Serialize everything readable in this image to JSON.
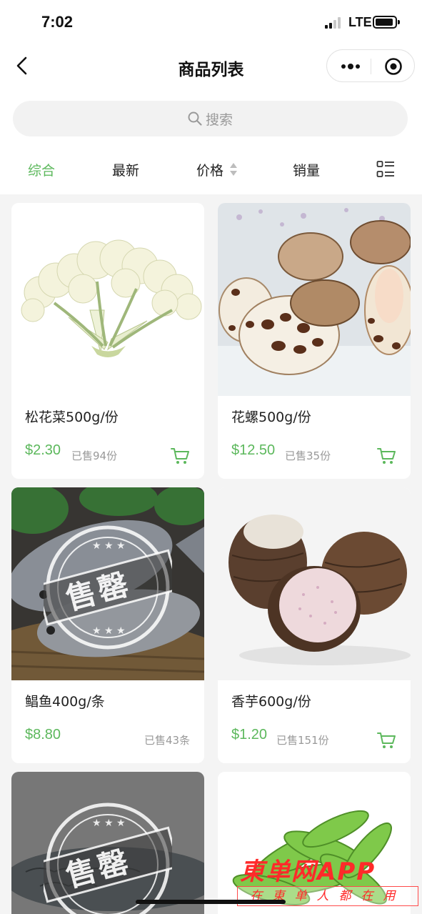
{
  "status_bar": {
    "time": "7:02",
    "network": "LTE"
  },
  "nav": {
    "title": "商品列表"
  },
  "search": {
    "placeholder": "搜索"
  },
  "sort_tabs": [
    {
      "label": "综合",
      "active": true
    },
    {
      "label": "最新"
    },
    {
      "label": "价格"
    },
    {
      "label": "销量"
    }
  ],
  "colors": {
    "accent": "#5cb85c",
    "price": "#5cb85c",
    "soldout_overlay": "rgba(255,255,255,0.8)",
    "watermark": "#ff2a2a"
  },
  "products": [
    {
      "name": "松花菜500g/份",
      "price": "$2.30",
      "sold": "已售94份",
      "sold_out": false,
      "image": "cauliflower"
    },
    {
      "name": "花螺500g/份",
      "price": "$12.50",
      "sold": "已售35份",
      "sold_out": false,
      "image": "spotted-babylon-snails"
    },
    {
      "name": "鲳鱼400g/条",
      "price": "$8.80",
      "sold": "已售43条",
      "sold_out": true,
      "image": "pomfret-fish"
    },
    {
      "name": "香芋600g/份",
      "price": "$1.20",
      "sold": "已售151份",
      "sold_out": false,
      "image": "taro"
    },
    {
      "name": "",
      "price": "",
      "sold": "",
      "sold_out": true,
      "image": "carp-fish"
    },
    {
      "name": "",
      "price": "",
      "sold": "",
      "sold_out": false,
      "image": "snow-peas"
    }
  ],
  "soldout_stamp": "售罄",
  "watermark": {
    "title": "東单网",
    "app": "APP",
    "slogan": "在東单人都在用"
  }
}
